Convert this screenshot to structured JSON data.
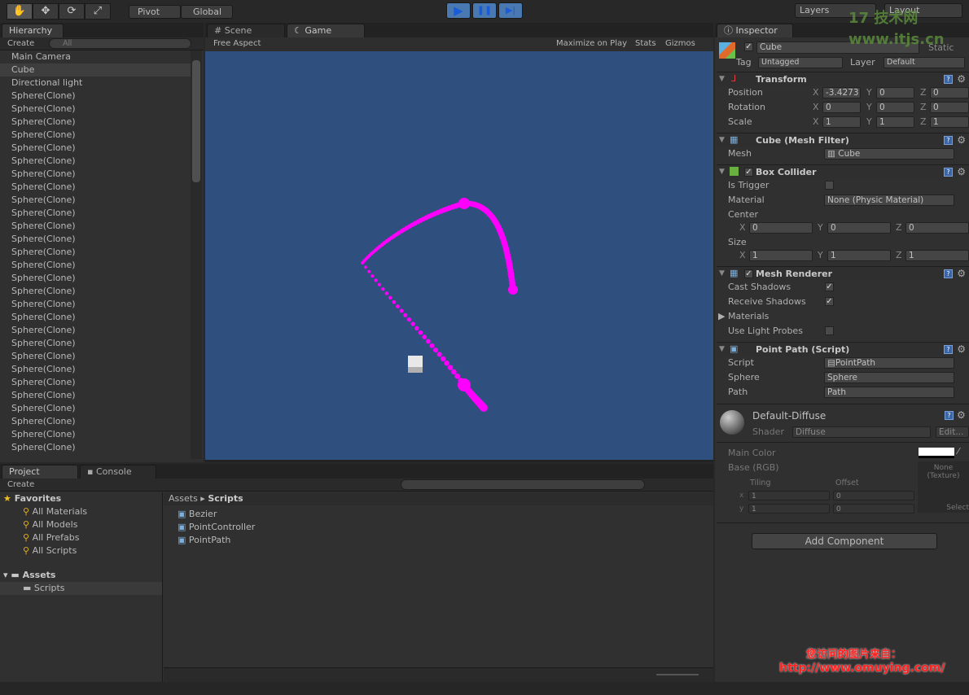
{
  "toolbar": {
    "pivot": "Pivot",
    "global": "Global",
    "layers": "Layers",
    "layout": "Layout"
  },
  "hierarchy": {
    "tab": "Hierarchy",
    "create": "Create",
    "search_placeholder": "All",
    "items": [
      "Main Camera",
      "Cube",
      "Directional light",
      "Sphere(Clone)",
      "Sphere(Clone)",
      "Sphere(Clone)",
      "Sphere(Clone)",
      "Sphere(Clone)",
      "Sphere(Clone)",
      "Sphere(Clone)",
      "Sphere(Clone)",
      "Sphere(Clone)",
      "Sphere(Clone)",
      "Sphere(Clone)",
      "Sphere(Clone)",
      "Sphere(Clone)",
      "Sphere(Clone)",
      "Sphere(Clone)",
      "Sphere(Clone)",
      "Sphere(Clone)",
      "Sphere(Clone)",
      "Sphere(Clone)",
      "Sphere(Clone)",
      "Sphere(Clone)",
      "Sphere(Clone)",
      "Sphere(Clone)",
      "Sphere(Clone)",
      "Sphere(Clone)",
      "Sphere(Clone)",
      "Sphere(Clone)",
      "Sphere(Clone)"
    ],
    "selected": "Cube"
  },
  "game": {
    "tab_scene": "Scene",
    "tab_game": "Game",
    "aspect": "Free Aspect",
    "maximize": "Maximize on Play",
    "stats": "Stats",
    "gizmos": "Gizmos",
    "background": "#2f4f7f",
    "path_color": "#ff00ff"
  },
  "project": {
    "tab_project": "Project",
    "tab_console": "Console",
    "create": "Create",
    "favorites_label": "Favorites",
    "favorites": [
      "All Materials",
      "All Models",
      "All Prefabs",
      "All Scripts"
    ],
    "assets_label": "Assets",
    "assets_children": [
      "Scripts"
    ],
    "breadcrumb": [
      "Assets",
      "Scripts"
    ],
    "files": [
      "Bezier",
      "PointController",
      "PointPath"
    ]
  },
  "inspector": {
    "tab": "Inspector",
    "object_name": "Cube",
    "static": "Static",
    "tag_label": "Tag",
    "tag": "Untagged",
    "layer_label": "Layer",
    "layer": "Default",
    "transform": {
      "title": "Transform",
      "rows": [
        {
          "label": "Position",
          "x": "-3.4273",
          "y": "0",
          "z": "0"
        },
        {
          "label": "Rotation",
          "x": "0",
          "y": "0",
          "z": "0"
        },
        {
          "label": "Scale",
          "x": "1",
          "y": "1",
          "z": "1"
        }
      ]
    },
    "mesh_filter": {
      "title": "Cube (Mesh Filter)",
      "mesh_label": "Mesh",
      "mesh": "Cube"
    },
    "box_collider": {
      "title": "Box Collider",
      "is_trigger": "Is Trigger",
      "material_label": "Material",
      "material": "None (Physic Material)",
      "center": "Center",
      "center_x": "0",
      "center_y": "0",
      "center_z": "0",
      "size": "Size",
      "size_x": "1",
      "size_y": "1",
      "size_z": "1"
    },
    "mesh_renderer": {
      "title": "Mesh Renderer",
      "cast_shadows": "Cast Shadows",
      "receive_shadows": "Receive Shadows",
      "materials": "Materials",
      "light_probes": "Use Light Probes"
    },
    "point_path": {
      "title": "Point Path (Script)",
      "script_label": "Script",
      "script": "PointPath",
      "sphere_label": "Sphere",
      "sphere": "Sphere",
      "path_label": "Path",
      "path": "Path"
    },
    "material": {
      "name": "Default-Diffuse",
      "shader_label": "Shader",
      "shader": "Diffuse",
      "edit": "Edit...",
      "main_color": "Main Color",
      "base": "Base (RGB)",
      "tiling": "Tiling",
      "offset": "Offset",
      "x": "x",
      "y": "y",
      "tx": "1",
      "ty": "1",
      "ox": "0",
      "oy": "0",
      "texture": "None (Texture)",
      "select": "Select"
    },
    "add_component": "Add Component"
  },
  "watermarks": {
    "top": "17 技术网 www.itjs.cn",
    "bottom_1": "您访问的图片来自：",
    "bottom_2": "http://www.omuying.com/"
  }
}
